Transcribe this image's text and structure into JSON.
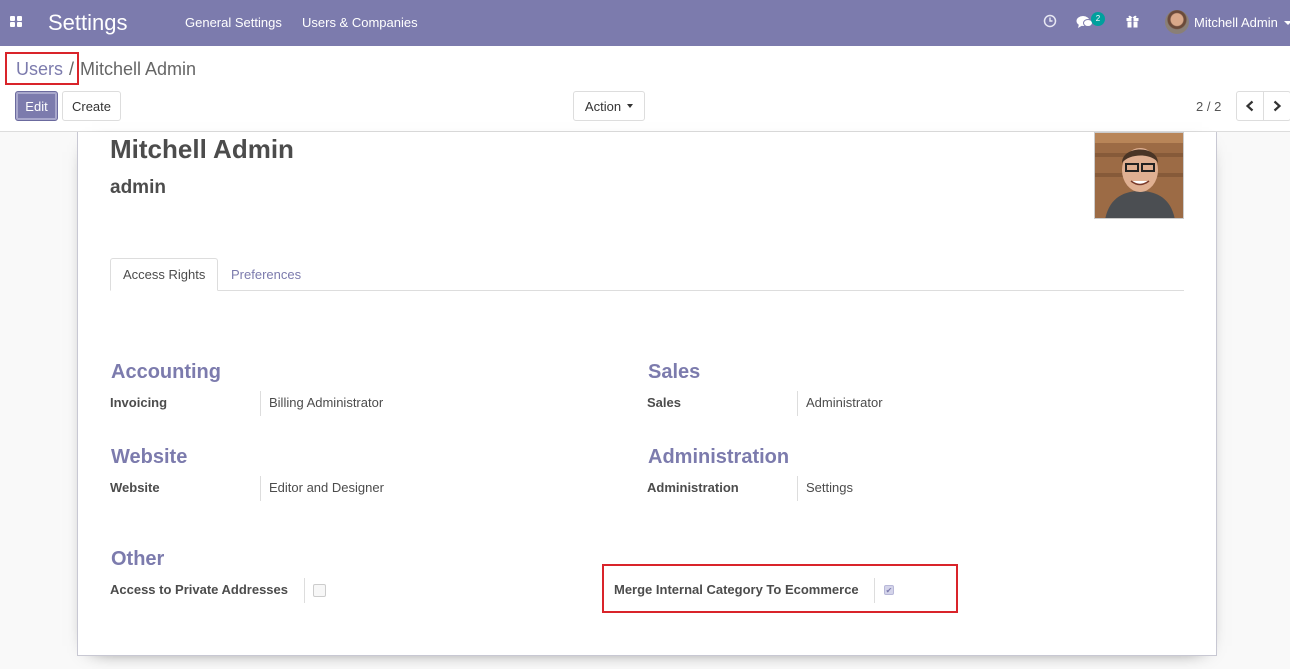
{
  "navbar": {
    "app_title": "Settings",
    "menu": [
      "General Settings",
      "Users & Companies"
    ],
    "messages_count": "2",
    "user_name": "Mitchell Admin",
    "icons": [
      "apps-grid-icon",
      "clock-icon",
      "chat-icon",
      "gift-icon"
    ]
  },
  "breadcrumb": {
    "parent": "Users",
    "separator": "/",
    "current": "Mitchell Admin"
  },
  "buttons": {
    "edit": "Edit",
    "create": "Create",
    "action": "Action"
  },
  "pager": {
    "value": "2 / 2"
  },
  "record": {
    "name": "Mitchell Admin",
    "login": "admin"
  },
  "tabs": [
    "Access Rights",
    "Preferences"
  ],
  "sections": {
    "accounting": {
      "title": "Accounting",
      "label": "Invoicing",
      "value": "Billing Administrator"
    },
    "sales": {
      "title": "Sales",
      "label": "Sales",
      "value": "Administrator"
    },
    "website": {
      "title": "Website",
      "label": "Website",
      "value": "Editor and Designer"
    },
    "administration": {
      "title": "Administration",
      "label": "Administration",
      "value": "Settings"
    },
    "other": {
      "title": "Other",
      "private_addresses": {
        "label": "Access to Private Addresses",
        "checked": false
      },
      "merge_category": {
        "label": "Merge Internal Category To Ecommerce",
        "checked": true
      }
    }
  },
  "colors": {
    "brand": "#7c7bad",
    "highlight": "#d9242a",
    "badge": "#00a09d"
  }
}
